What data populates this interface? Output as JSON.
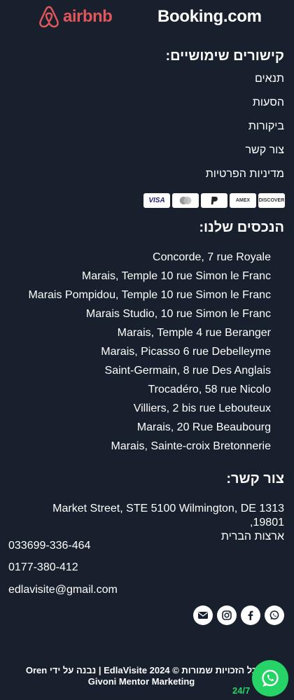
{
  "header": {
    "airbnb_label": "airbnb",
    "booking_label": "Booking.com",
    "airbnb_color": "#e0565b"
  },
  "useful_links": {
    "title": "קישורים שימושיים:",
    "items": [
      "תנאים",
      "הסעות",
      "ביקורות",
      "צור קשר",
      "מדיניות הפרטיות"
    ]
  },
  "payments": {
    "cards": [
      {
        "label": "DISCOVER",
        "icon": "discover-icon"
      },
      {
        "label": "AMEX",
        "icon": "amex-icon"
      },
      {
        "label": "P",
        "icon": "paypal-icon"
      },
      {
        "label": "●●",
        "icon": "mastercard-icon"
      },
      {
        "label": "VISA",
        "icon": "visa-icon"
      }
    ]
  },
  "properties": {
    "title": "הנכסים שלנו:",
    "items": [
      "Concorde, 7 rue Royale",
      "Marais, Temple 10 rue Simon le Franc",
      "Marais Pompidou, Temple 10 rue Simon le Franc",
      "Marais Studio, 10 rue Simon le Franc",
      "Marais, Temple 4 rue Beranger",
      "Marais, Picasso 6 rue Debelleyme",
      "Saint-Germain, 8 rue Des Anglais",
      "Trocadéro, 58 rue Nicolo",
      "Villiers, 2 bis rue Lebouteux",
      "Marais, 20 Rue Beaubourg",
      "Marais, Sainte-croix Bretonnerie"
    ]
  },
  "contact": {
    "title": "צור קשר:",
    "address_line1": "1313 Market Street, STE 5100 Wilmington, DE 19801,",
    "address_line2": "ארצות הברית",
    "phone1": "033699-336-464",
    "phone2": "0177-380-412",
    "email": "edlavisite@gmail.com"
  },
  "socials": [
    "whatsapp-icon",
    "facebook-icon",
    "instagram-icon",
    "email-icon"
  ],
  "footer": {
    "copyright": "כל הזכויות שמורות © EdlaVisite 2024 | נבנה על ידי Oren Givoni Mentor Marketing",
    "badge": "24/7"
  },
  "colors": {
    "background": "#17202c",
    "whatsapp": "#25d366"
  }
}
